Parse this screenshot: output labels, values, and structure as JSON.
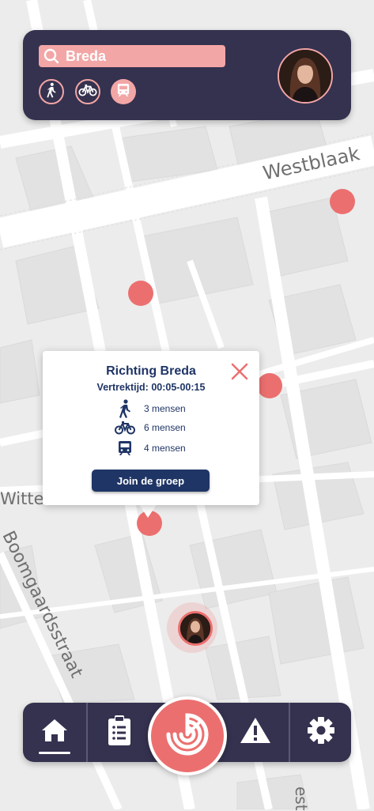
{
  "search": {
    "value": "Breda",
    "placeholder": ""
  },
  "transport_modes": [
    {
      "name": "walk-icon",
      "selected": false
    },
    {
      "name": "bike-icon",
      "selected": false
    },
    {
      "name": "train-icon",
      "selected": true
    }
  ],
  "map": {
    "street_labels": [
      "Westblaak",
      "Boomgaardsstraat",
      "Witte de With",
      "est"
    ]
  },
  "popup": {
    "title": "Richting Breda",
    "subtitle": "Vertrektijd: 00:05-00:15",
    "stats": [
      {
        "icon": "walk-icon",
        "text": "3 mensen"
      },
      {
        "icon": "bike-icon",
        "text": "6 mensen"
      },
      {
        "icon": "train-icon",
        "text": "4 mensen"
      }
    ],
    "join_label": "Join de groep"
  },
  "bottom_nav": {
    "items": [
      "home-icon",
      "clipboard-list-icon",
      "radar-icon",
      "warning-icon",
      "gear-icon"
    ],
    "active": "home-icon"
  },
  "colors": {
    "panel": "#34324f",
    "accent": "#f3a6a6",
    "pin": "#ec6f6f",
    "primary": "#1f3566"
  }
}
